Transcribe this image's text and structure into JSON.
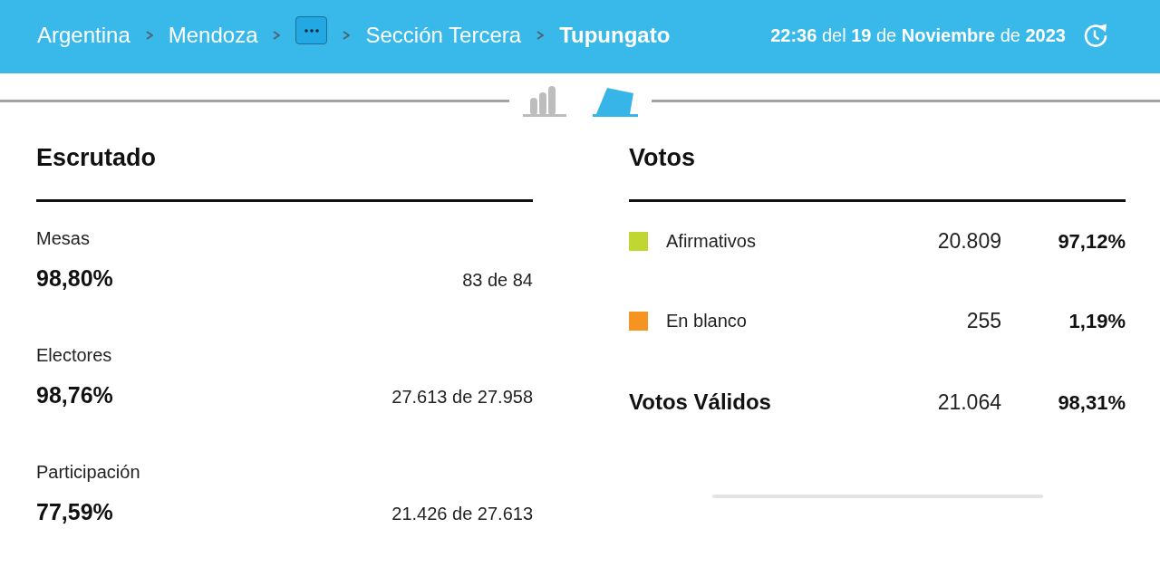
{
  "breadcrumb": [
    {
      "kind": "link",
      "label": "Argentina",
      "current": false
    },
    {
      "kind": "link",
      "label": "Mendoza",
      "current": false
    },
    {
      "kind": "more"
    },
    {
      "kind": "link",
      "label": "Sección Tercera",
      "current": false
    },
    {
      "kind": "link",
      "label": "Tupungato",
      "current": true
    }
  ],
  "updated": "**22:36** del **19** de **Noviembre** de **2023**",
  "tabs": [
    {
      "kind": "chart",
      "selected": false
    },
    {
      "kind": "ballot",
      "selected": true
    }
  ],
  "escrutado": {
    "title": "Escrutado",
    "rows": [
      {
        "label": "Mesas",
        "percent": "98,80%",
        "count": "83 de 84"
      },
      {
        "label": "Electores",
        "percent": "98,76%",
        "count": "27.613 de 27.958"
      },
      {
        "label": "Participación",
        "percent": "77,59%",
        "count": "21.426 de 27.613"
      }
    ]
  },
  "votos": {
    "title": "Votos",
    "rows": [
      {
        "kind": "option",
        "label": "Afirmativos",
        "color": "#c0d631",
        "votes": "20.809",
        "percent": "97,12%"
      },
      {
        "kind": "option",
        "label": "En blanco",
        "color": "#f59420",
        "votes": "255",
        "percent": "1,19%"
      },
      {
        "kind": "total",
        "label": "Votos Válidos",
        "votes": "21.064",
        "percent": "98,31%"
      }
    ]
  }
}
